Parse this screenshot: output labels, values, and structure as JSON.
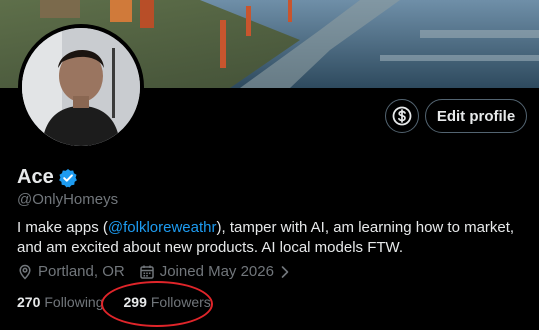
{
  "profile": {
    "name": "Ace",
    "handle": "@OnlyHomeys",
    "bio_prefix": "I make apps (",
    "bio_mention": "@folkloreweathr",
    "bio_suffix": "), tamper with AI, am learning how to market, and am excited about new products. AI local models FTW.",
    "location": "Portland, OR",
    "joined": "Joined May 2026"
  },
  "actions": {
    "edit_label": "Edit profile"
  },
  "stats": {
    "following_count": "270",
    "following_label": "Following",
    "followers_count": "299",
    "followers_label": "Followers"
  },
  "icons": {
    "verified": "verified-badge-icon",
    "subscribe": "dollar-subscribe-icon",
    "location": "location-pin-icon",
    "calendar": "calendar-icon",
    "chevron": "chevron-right-icon"
  },
  "colors": {
    "background": "#000000",
    "text_primary": "#e7e9ea",
    "text_secondary": "#71767b",
    "accent": "#1d9bf0",
    "annotation": "#e0252a"
  }
}
